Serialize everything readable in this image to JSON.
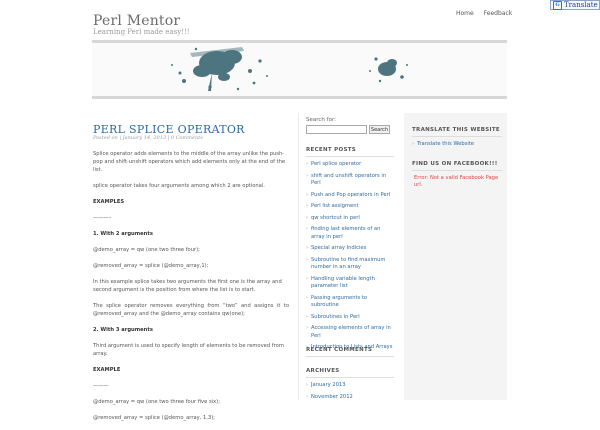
{
  "site": {
    "title": "Perl Mentor",
    "tagline": "Learning Perl made easy!!!"
  },
  "topnav": [
    "Home",
    "Feedback"
  ],
  "translate": {
    "label": "Translate"
  },
  "post": {
    "title": "PERL SPLICE OPERATOR",
    "meta": "Posted on | January 14, 2013 | 0 Comments",
    "paragraphs": [
      "Splice operator adds elements to the middle of the array unlike the push-pop and shift-unshift operators which add elements only at the end of the list.",
      "splice operator takes four arguments among which 2 are optional.",
      "EXAMPLES",
      "———–",
      "1. With 2 arguments",
      "@demo_array = qw (one two three four);",
      "@removed_array = splice (@demo_array,1);",
      "In this example splice takes two arguments the first one is the array and second argument is the position from where the list is to start.",
      "The splice operator removes everything from “two” and assigns it to @removed_array and the @demo_array contains qw(one);",
      "2. With 3 arguments",
      "Third argument is used to specify length of elements to be removed from array.",
      "EXAMPLE",
      "———",
      "@demo_array = qw (one two three four five six);",
      "@removed_array = splice (@demo_array, 1,3);"
    ]
  },
  "sidebar": {
    "search_label": "Search for:",
    "search_value": "",
    "search_button": "Search",
    "recent_posts_title": "RECENT POSTS",
    "recent_posts": [
      "Perl splice operator",
      "shift and unshift operators in Perl",
      "Push and Pop operators in Perl",
      "Perl list assigment",
      "qw shortcut in perl",
      "finding last elements of an array in perl",
      "Special array Indicies",
      "Subroutine to find maximum number in an array",
      "Handling variable length parameter list",
      "Passing arguments to subroutine",
      "Subroutines in Perl",
      "Accessing elements of array in Perl",
      "Introduction to Lists and Arrays"
    ],
    "recent_comments_title": "RECENT COMMENTS",
    "archives_title": "ARCHIVES",
    "archives": [
      "January 2013",
      "November 2012"
    ]
  },
  "right": {
    "translate_title": "TRANSLATE THIS WEBSITE",
    "translate_link": "Translate this Website",
    "facebook_title": "FIND US ON FACEBOOK!!!",
    "facebook_error": "Error: Not a valid Facebook Page url."
  }
}
